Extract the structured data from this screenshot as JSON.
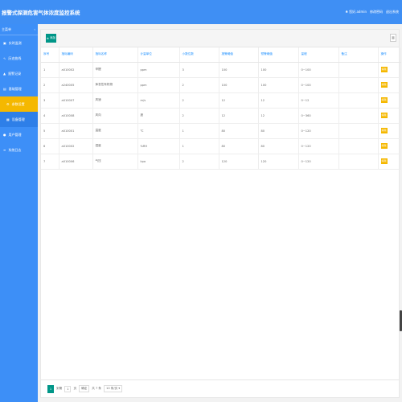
{
  "header": {
    "title": "报警式探测危害气体浓度监控系统",
    "user": "♣ 您好,admin",
    "change_pwd": "修改密码",
    "logout": "退出系统"
  },
  "sidebar": {
    "title": "主菜单",
    "collapse_icon": "chevron-left-icon",
    "items": [
      {
        "label": "实时监测",
        "icon": "monitor-icon",
        "state": "normal"
      },
      {
        "label": "历史曲线",
        "icon": "chart-icon",
        "state": "normal"
      },
      {
        "label": "报警记录",
        "icon": "alarm-icon",
        "state": "normal"
      },
      {
        "label": "基础管理",
        "icon": "folder-icon",
        "state": "normal"
      },
      {
        "label": "参数设置",
        "icon": "settings-icon",
        "state": "active"
      },
      {
        "label": "设备管理",
        "icon": "device-icon",
        "state": "sub"
      },
      {
        "label": "用户管理",
        "icon": "user-icon",
        "state": "normal"
      },
      {
        "label": "系统日志",
        "icon": "log-icon",
        "state": "normal"
      }
    ]
  },
  "toolbar": {
    "add_label": "添加",
    "tool_icon": "filter-columns-icon"
  },
  "table": {
    "headers": [
      "序号",
      "指标编码",
      "指标名称",
      "计量单位",
      "小数位数",
      "报警阈值",
      "预警阈值",
      "量程",
      "备注",
      "操作"
    ],
    "rows": [
      [
        "1",
        "a010002",
        "甲醛",
        "ppm",
        "3",
        "100",
        "100",
        "0~100",
        "",
        "编辑"
      ],
      [
        "2",
        "a240005",
        "挥发性有机物",
        "ppm",
        "2",
        "100",
        "100",
        "0~100",
        "",
        "编辑"
      ],
      [
        "3",
        "a010007",
        "风速",
        "m/s",
        "2",
        "12",
        "12",
        "0~12",
        "",
        "编辑"
      ],
      [
        "4",
        "a010008",
        "风向",
        "度",
        "2",
        "12",
        "12",
        "0~360",
        "",
        "编辑"
      ],
      [
        "5",
        "a010001",
        "温度",
        "℃",
        "1",
        "80",
        "80",
        "0~120",
        "",
        "编辑"
      ],
      [
        "6",
        "a010002",
        "湿度",
        "%RH",
        "1",
        "80",
        "80",
        "0~120",
        "",
        "编辑"
      ],
      [
        "7",
        "a010006",
        "气压",
        "kpa",
        "2",
        "120",
        "120",
        "0~120",
        "",
        "编辑"
      ]
    ]
  },
  "pager": {
    "current": "1",
    "goto_label": "到第",
    "goto_value": "1",
    "page_unit": "页",
    "confirm": "确定",
    "total": "共 7 条",
    "page_size": "10 条/页"
  },
  "colors": {
    "header_bg": "#3f8ff4",
    "sidebar_bg": "#3d8ff7",
    "active_bg": "#f5b800",
    "add_btn": "#009688"
  }
}
